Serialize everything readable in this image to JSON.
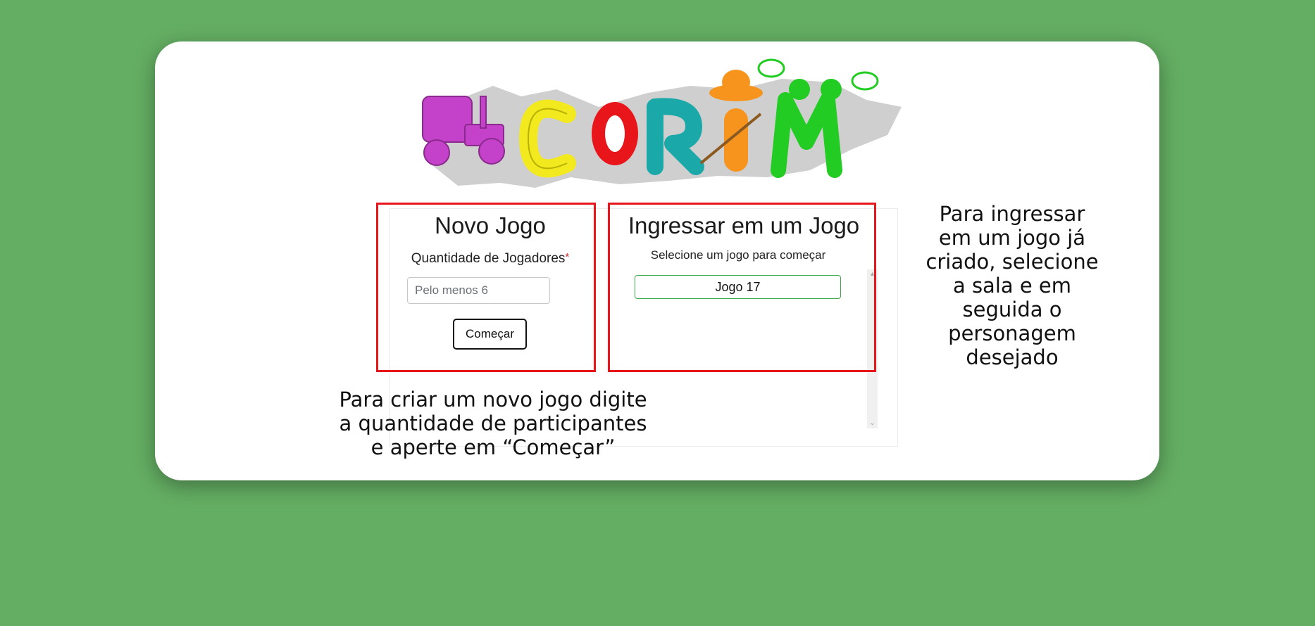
{
  "logo": {
    "text": "CORIM",
    "alt": "CORIM logo"
  },
  "novo_jogo": {
    "title": "Novo Jogo",
    "quantity_label": "Quantidade de Jogadores",
    "required_mark": "*",
    "input_placeholder": "Pelo menos 6",
    "input_value": "",
    "start_label": "Começar"
  },
  "ingressar": {
    "title": "Ingressar em um Jogo",
    "subtitle": "Selecione um jogo para começar",
    "games": [
      "Jogo 17"
    ]
  },
  "annotations": {
    "create_lines": [
      "Para criar um novo jogo digite",
      "a quantidade de participantes",
      "e aperte em “Começar”"
    ],
    "join_lines": [
      "Para ingressar",
      "em um jogo já",
      "criado, selecione",
      "a sala e em",
      "seguida o",
      "personagem",
      "desejado"
    ]
  },
  "colors": {
    "background": "#64ae63",
    "highlight": "#e8161b",
    "game_border": "#3fa84a",
    "logo_letters": [
      "#c441c9",
      "#f2ea1e",
      "#e8161b",
      "#1aa8a8",
      "#f7941d",
      "#22cc22"
    ]
  }
}
